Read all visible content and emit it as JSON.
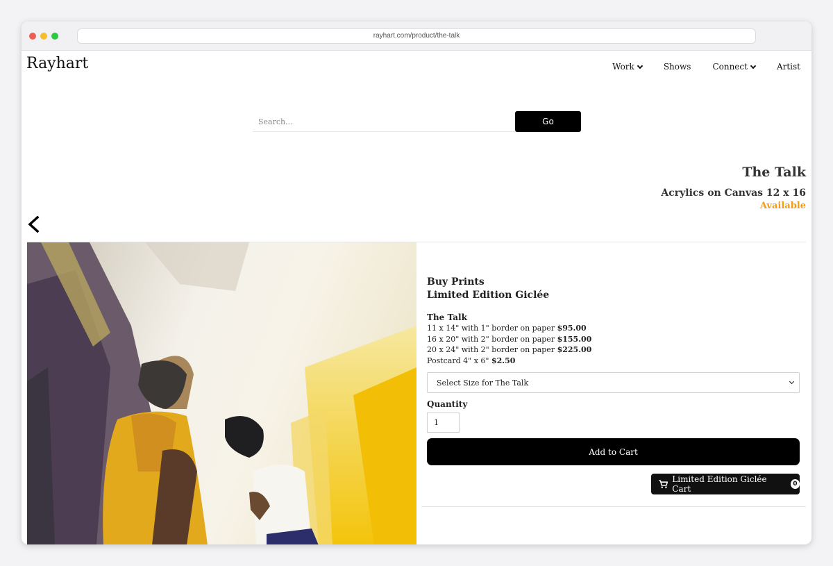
{
  "browser": {
    "url": "rayhart.com/product/the-talk"
  },
  "header": {
    "brand": "Rayhart",
    "nav": [
      {
        "label": "Work"
      },
      {
        "label": "Shows"
      },
      {
        "label": "Connect"
      },
      {
        "label": "Artist"
      }
    ]
  },
  "search": {
    "placeholder": "Search...",
    "button_label": "Go"
  },
  "artwork": {
    "title": "The Talk",
    "medium": "Acrylics on Canvas 12 x 16",
    "status": "Available"
  },
  "prints": {
    "heading_line1": "Buy Prints",
    "heading_line2": "Limited Edition Giclée",
    "product_name": "The Talk",
    "options": [
      {
        "desc": "11 x 14\" with 1\" border on paper ",
        "price": "$95.00"
      },
      {
        "desc": "16 x 20\" with 2\" border on paper ",
        "price": "$155.00"
      },
      {
        "desc": "20 x 24\" with 2\" border on paper ",
        "price": "$225.00"
      },
      {
        "desc": "Postcard 4\" x 6\" ",
        "price": "$2.50"
      }
    ],
    "select_placeholder": "Select Size for The Talk",
    "quantity_label": "Quantity",
    "quantity_value": "1",
    "add_to_cart_label": "Add to Cart",
    "cart_label": "Limited Edition Giclée Cart",
    "cart_count": "0"
  },
  "colors": {
    "accent": "#f39c12",
    "button": "#000000"
  }
}
